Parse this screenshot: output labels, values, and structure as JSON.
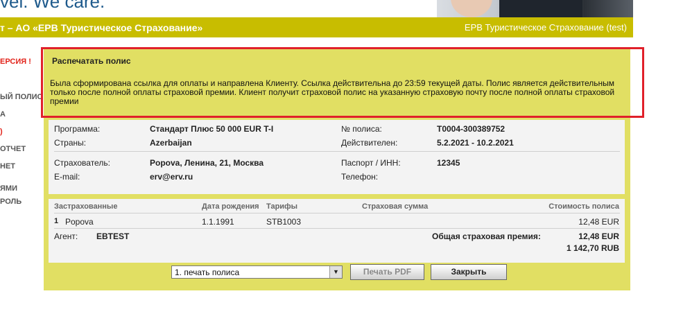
{
  "header": {
    "slogan": "vel. We care.",
    "company_left": "т – АО «ЕРВ Туристическое Страхование»",
    "company_right": "ЕРВ Туристическое Страхование (test)"
  },
  "sidebar": {
    "items": [
      {
        "label": "ЕРСИЯ !",
        "color": "#e2231a"
      },
      {
        "label": "ЫЙ ПОЛИС"
      },
      {
        "label": "А"
      },
      {
        "label": ")",
        "color": "#e2231a"
      },
      {
        "label": "ОТЧЕТ"
      },
      {
        "label": "НЕТ"
      },
      {
        "label": "ЯМИ"
      },
      {
        "label": "РОЛЬ"
      }
    ]
  },
  "panel": {
    "title": "Распечатать полис",
    "message": "Была сформирована ссылка для оплаты и направлена Клиенту. Ссылка действительна до 23:59 текущей даты. Полис является действительным только после полной оплаты страховой премии. Клиент получит страховой полис на указанную страховую почту после полной оплаты страховой премии"
  },
  "policy": {
    "program_label": "Программа:",
    "program_value": "Стандарт Плюс 50 000 EUR T-I",
    "countries_label": "Страны:",
    "countries_value": "Azerbaijan",
    "policy_no_label": "№ полиса:",
    "policy_no_value": "T0004-300389752",
    "valid_label": "Действителен:",
    "valid_value": "5.2.2021  -  10.2.2021",
    "insurer_label": "Страхователь:",
    "insurer_value": "Popova, Ленина, 21, Москва",
    "passport_label": "Паспорт / ИНН:",
    "passport_value": "12345",
    "email_label": "E-mail:",
    "email_value": "erv@erv.ru",
    "phone_label": "Телефон:",
    "phone_value": ""
  },
  "insured_table": {
    "columns": [
      "Застрахованные",
      "Дата рождения",
      "Тарифы",
      "Страховая сумма",
      "Стоимость полиса"
    ],
    "rows": [
      {
        "num": "1",
        "name": "Popova",
        "dob": "1.1.1991",
        "tariff": "STB1003",
        "sum": "",
        "cost": "12,48 EUR"
      }
    ],
    "agent_label": "Агент:",
    "agent_value": "EBTEST",
    "total_label": "Общая страховая премия:",
    "total_eur": "12,48 EUR",
    "total_rub": "1 142,70 RUB"
  },
  "actions": {
    "print_select_value": "1. печать полиса",
    "print_pdf_label": "Печать PDF",
    "close_label": "Закрыть"
  },
  "colors": {
    "bar": "#c8bd00",
    "panel": "#e1df63",
    "highlight": "#e0202a"
  }
}
